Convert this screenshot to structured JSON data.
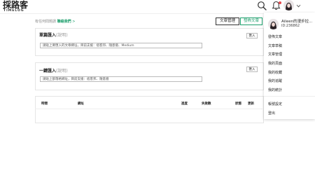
{
  "header": {
    "logo_main": "採路客",
    "logo_sub": "TIMELOG",
    "icons": [
      "search-icon",
      "bell-icon",
      "avatar",
      "chevron-down-icon"
    ],
    "notification_color": "#e5484d"
  },
  "top_bar": {
    "question_text": "有任何問題請",
    "contact_link": "聯絡我們",
    "contact_arrow": ">",
    "manage_button": "文章管理",
    "publish_button": "發佈文章",
    "accent_color": "#1a9d6a"
  },
  "single_import": {
    "title": "單篇匯入",
    "help": "(說明)",
    "input_placeholder": "請貼上要匯入的文章網址，目前支援：痞客邦、隨意窩、Medium",
    "button": "匯入"
  },
  "batch_import": {
    "title": "一鍵匯入",
    "help": "(說明)",
    "input_placeholder": "請貼上部落格網址，目前支援：痞客邦、隨意窩",
    "button": "匯入"
  },
  "table": {
    "columns": [
      "時間",
      "網址",
      "進度",
      "失敗數",
      "狀態",
      "更新"
    ]
  },
  "user_menu": {
    "name": "Aileen的漫步拉...",
    "id": "ID:236862",
    "items": [
      "發佈文章",
      "文章草稿",
      "文章管理",
      "我的頁面",
      "我的收藏",
      "我的追蹤",
      "我的統計"
    ],
    "footer_items": [
      "帳號設定",
      "登出"
    ]
  }
}
